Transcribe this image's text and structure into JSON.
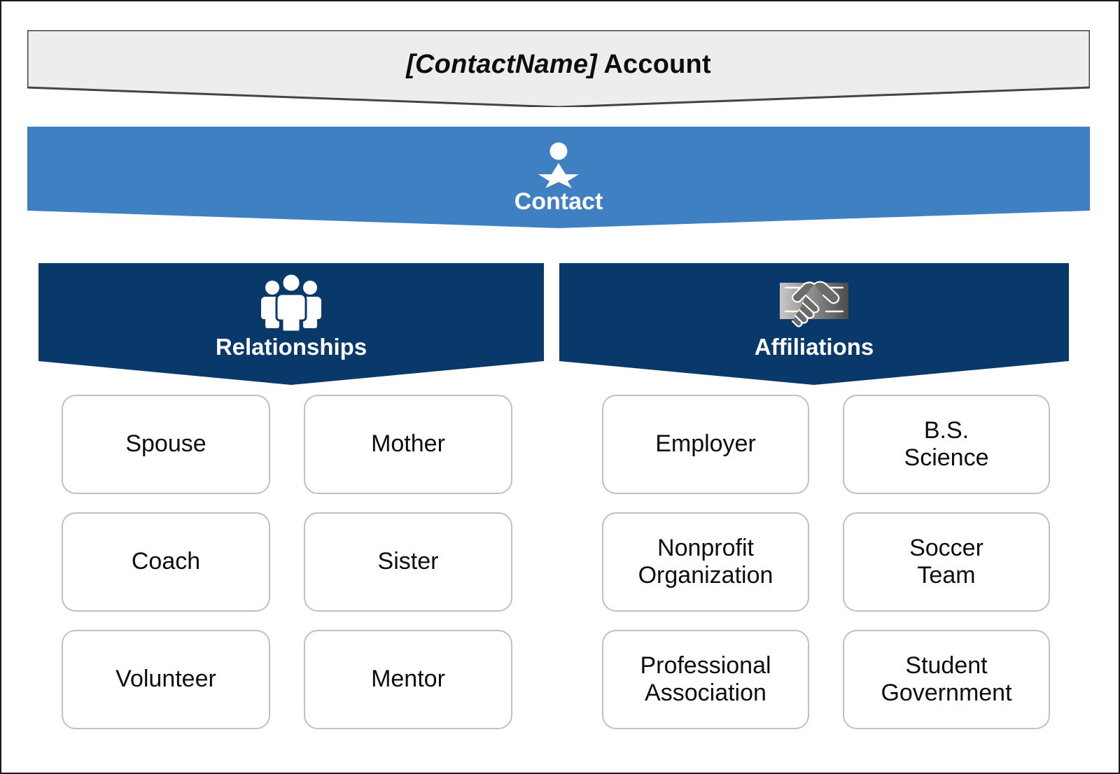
{
  "diagram": {
    "account_banner": {
      "placeholder": "[ContactName]",
      "suffix": " Account",
      "bg_color": "#EDEDED",
      "border_color": "#444444"
    },
    "contact_band": {
      "label": "Contact",
      "icon": "person-icon",
      "bg_color": "#3E80C1",
      "text_color": "#FFFFFF"
    },
    "branches": [
      {
        "id": "relationships",
        "label": "Relationships",
        "icon": "people-group-icon",
        "bg_color": "#09386B",
        "text_color": "#FFFFFF",
        "cards": [
          [
            "Spouse",
            "Mother"
          ],
          [
            "Coach",
            "Sister"
          ],
          [
            "Volunteer",
            "Mentor"
          ]
        ]
      },
      {
        "id": "affiliations",
        "label": "Affiliations",
        "icon": "handshake-icon",
        "bg_color": "#09386B",
        "text_color": "#FFFFFF",
        "cards": [
          [
            "Employer",
            "B.S.\nScience"
          ],
          [
            "Nonprofit\nOrganization",
            "Soccer\nTeam"
          ],
          [
            "Professional\nAssociation",
            "Student\nGovernment"
          ]
        ]
      }
    ],
    "card_style": {
      "bg_color": "#FFFFFF",
      "border_color": "#C0C0C0",
      "text_color": "#0D0D0D"
    }
  }
}
